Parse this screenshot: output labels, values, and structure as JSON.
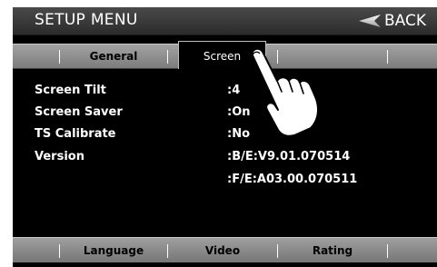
{
  "header": {
    "title": "SETUP MENU",
    "back_label": "BACK"
  },
  "tabs": {
    "general": "General",
    "screen": "Screen"
  },
  "settings": [
    {
      "label": "Screen Tilt",
      "value": ":4"
    },
    {
      "label": "Screen Saver",
      "value": ":On"
    },
    {
      "label": "TS Calibrate",
      "value": ":No"
    },
    {
      "label": "Version",
      "value": ":B/E:V9.01.070514"
    },
    {
      "label": "",
      "value": ":F/E:A03.00.070511"
    }
  ],
  "bottom_tabs": {
    "language": "Language",
    "video": "Video",
    "rating": "Rating"
  },
  "icons": {
    "back": "back-arrow-icon",
    "pointer": "pointing-hand-icon"
  }
}
